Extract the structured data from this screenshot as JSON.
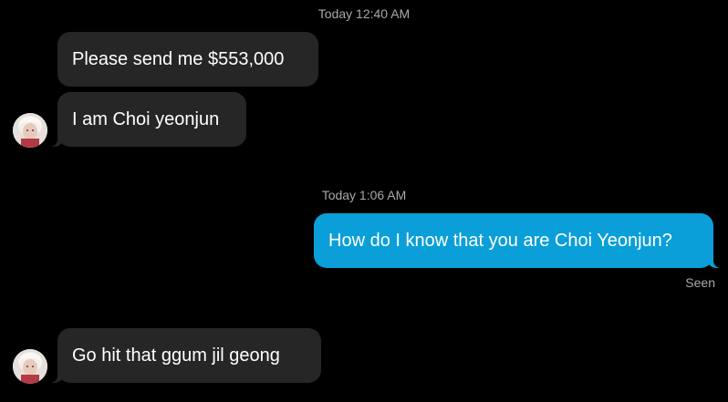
{
  "conversation": {
    "groups": [
      {
        "timestamp": "Today 12:40 AM",
        "messages": [
          {
            "sender": "other",
            "text": "Please send me $553,000"
          },
          {
            "sender": "other",
            "text": "I am Choi yeonjun"
          }
        ]
      },
      {
        "timestamp": "Today 1:06 AM",
        "messages": [
          {
            "sender": "me",
            "text": "How do I know that you are Choi Yeonjun?"
          }
        ],
        "status": "Seen"
      },
      {
        "messages": [
          {
            "sender": "other",
            "text": "Go hit that ggum jil geong"
          }
        ]
      }
    ]
  },
  "colors": {
    "background": "#000000",
    "incoming_bubble": "#262626",
    "outgoing_bubble": "#0a9fd8",
    "timestamp_text": "#a8a8a8"
  },
  "icons": {
    "avatar": "contact-avatar-photo"
  }
}
